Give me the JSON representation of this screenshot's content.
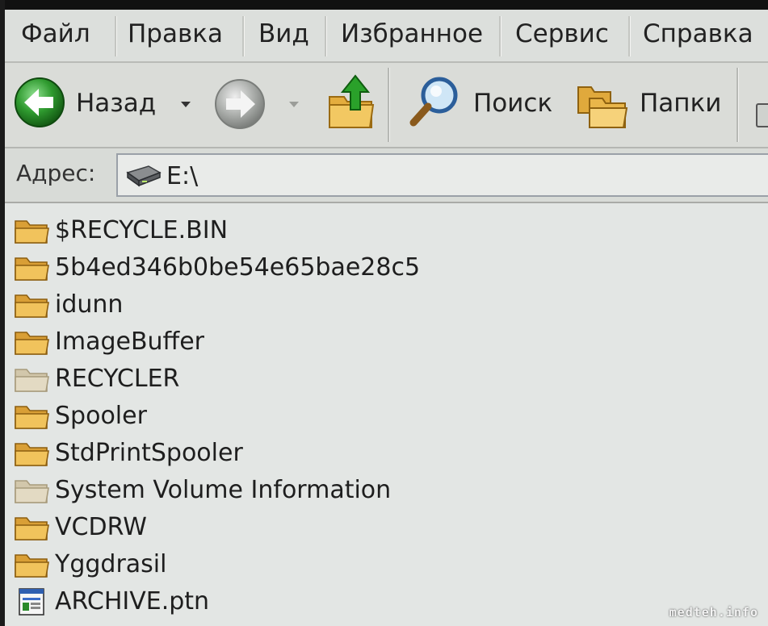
{
  "menubar": {
    "items": [
      {
        "label": "Файл"
      },
      {
        "label": "Правка"
      },
      {
        "label": "Вид"
      },
      {
        "label": "Избранное"
      },
      {
        "label": "Сервис"
      },
      {
        "label": "Справка"
      }
    ]
  },
  "toolbar": {
    "back_label": "Назад",
    "search_label": "Поиск",
    "folders_label": "Папки"
  },
  "address": {
    "label": "Адрес:",
    "value": "E:\\"
  },
  "files": [
    {
      "name": "$RECYCLE.BIN",
      "icon": "folder-icon",
      "style": "normal"
    },
    {
      "name": "5b4ed346b0be54e65bae28c5",
      "icon": "folder-icon",
      "style": "normal"
    },
    {
      "name": "idunn",
      "icon": "folder-icon",
      "style": "normal"
    },
    {
      "name": "ImageBuffer",
      "icon": "folder-icon",
      "style": "normal"
    },
    {
      "name": "RECYCLER",
      "icon": "folder-icon",
      "style": "hidden"
    },
    {
      "name": "Spooler",
      "icon": "folder-icon",
      "style": "normal"
    },
    {
      "name": "StdPrintSpooler",
      "icon": "folder-icon",
      "style": "normal"
    },
    {
      "name": "System Volume Information",
      "icon": "folder-icon",
      "style": "hidden"
    },
    {
      "name": "VCDRW",
      "icon": "folder-icon",
      "style": "normal"
    },
    {
      "name": "Yggdrasil",
      "icon": "folder-icon",
      "style": "normal"
    },
    {
      "name": "ARCHIVE.ptn",
      "icon": "file-icon",
      "style": "normal"
    }
  ],
  "watermark": "medteh.info",
  "colors": {
    "folder": "#e8b64a",
    "folder_hidden": "#d6c9a6",
    "back_green": "#2e8b2e"
  }
}
